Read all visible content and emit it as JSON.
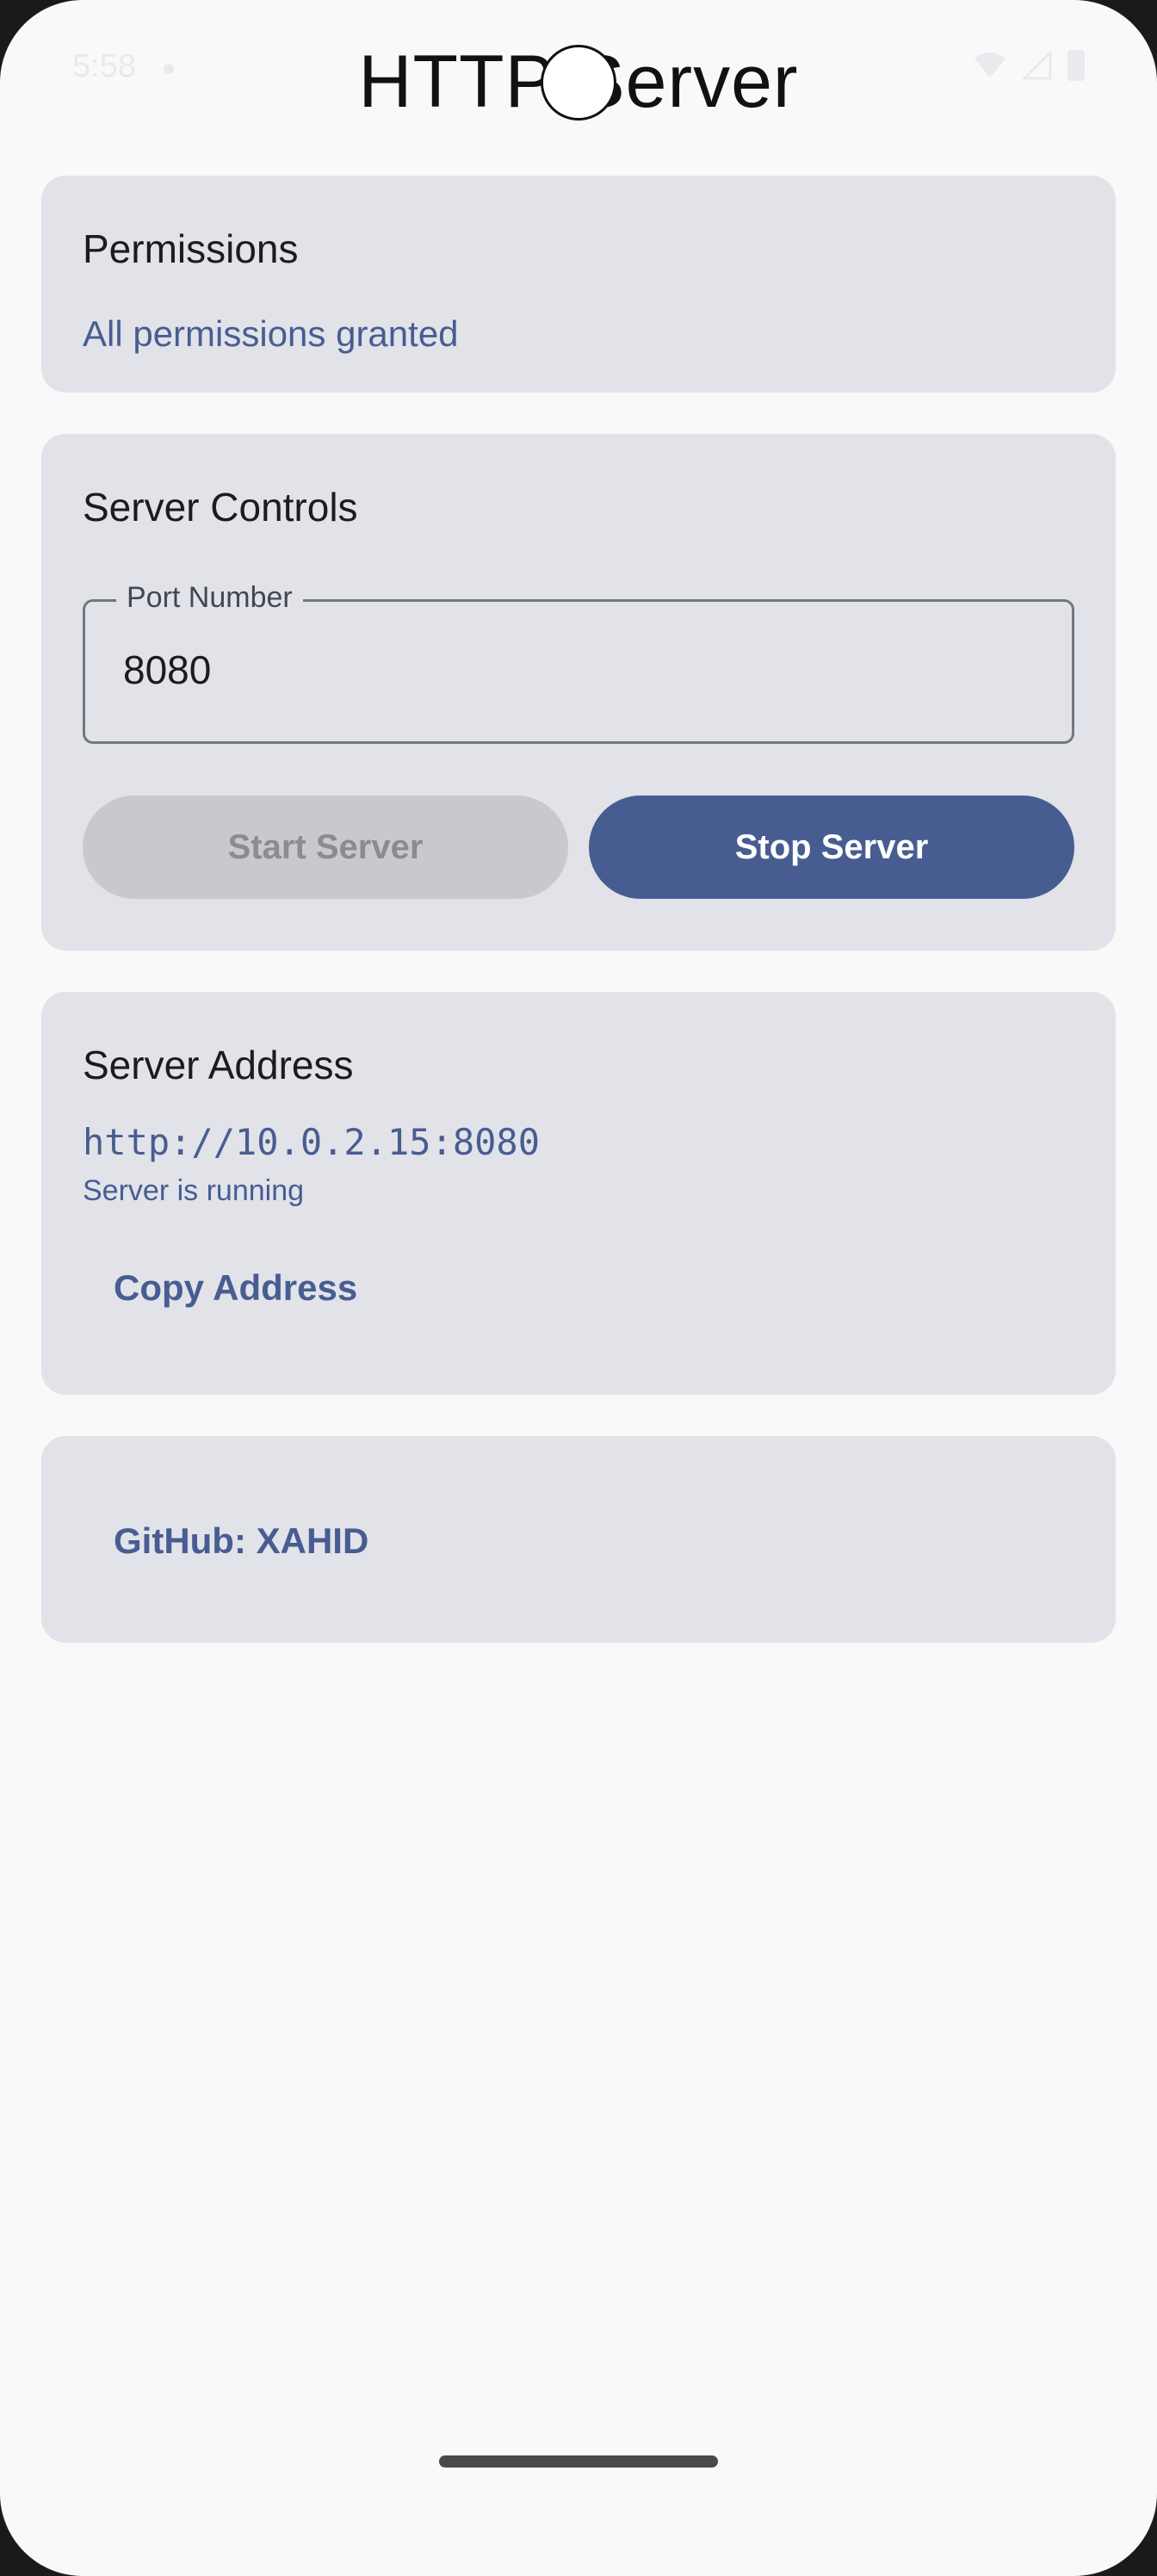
{
  "status_bar": {
    "time": "5:58",
    "icons": [
      "wifi-icon",
      "cellular-icon",
      "battery-icon"
    ]
  },
  "app": {
    "title": "HTTP Server"
  },
  "permissions_card": {
    "title": "Permissions",
    "status": "All permissions granted"
  },
  "server_controls": {
    "title": "Server Controls",
    "port_label": "Port Number",
    "port_value": "8080",
    "start_label": "Start Server",
    "stop_label": "Stop Server"
  },
  "server_address": {
    "title": "Server Address",
    "url": "http://10.0.2.15:8080",
    "status": "Server is running",
    "copy_label": "Copy Address"
  },
  "footer_card": {
    "github_label": "GitHub: XAHID"
  },
  "colors": {
    "primary": "#475d92",
    "card_background": "#e2e2e9",
    "screen_background": "#f9f9f9"
  }
}
